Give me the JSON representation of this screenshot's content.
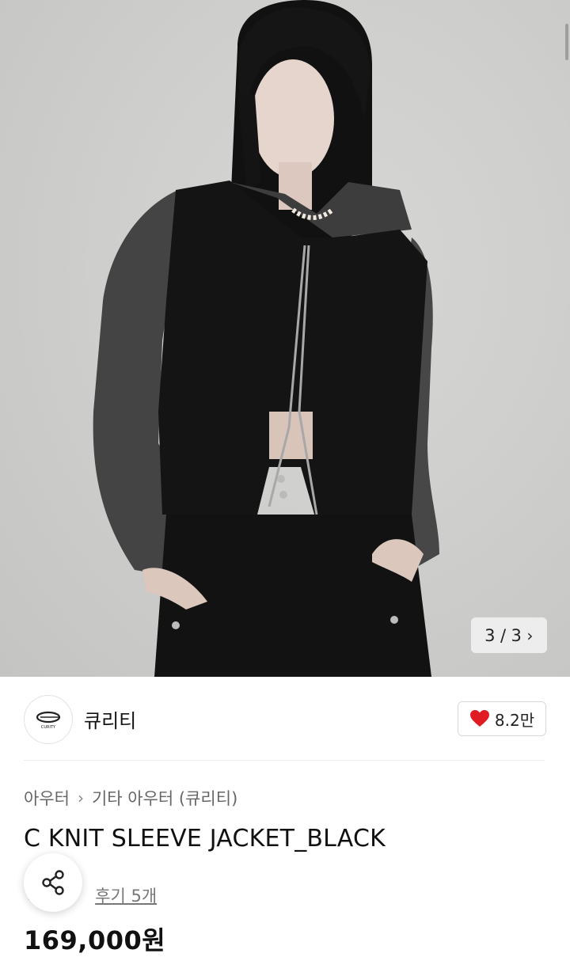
{
  "gallery": {
    "current": "3",
    "separator": "/",
    "total": "3",
    "next_glyph": "›"
  },
  "brand": {
    "name": "큐리티",
    "logo_text": "CURITY",
    "like_count": "8.2만",
    "heart_color": "#e11b22"
  },
  "breadcrumb": {
    "items": [
      "아우터",
      "기타 아우터 (큐리티)"
    ],
    "separator": "›"
  },
  "product": {
    "title": "C KNIT SLEEVE JACKET_BLACK",
    "review_text": "후기 5개",
    "price": "169,000원"
  },
  "icons": {
    "share": "share-icon",
    "heart": "heart-icon",
    "star": "star-icon"
  }
}
